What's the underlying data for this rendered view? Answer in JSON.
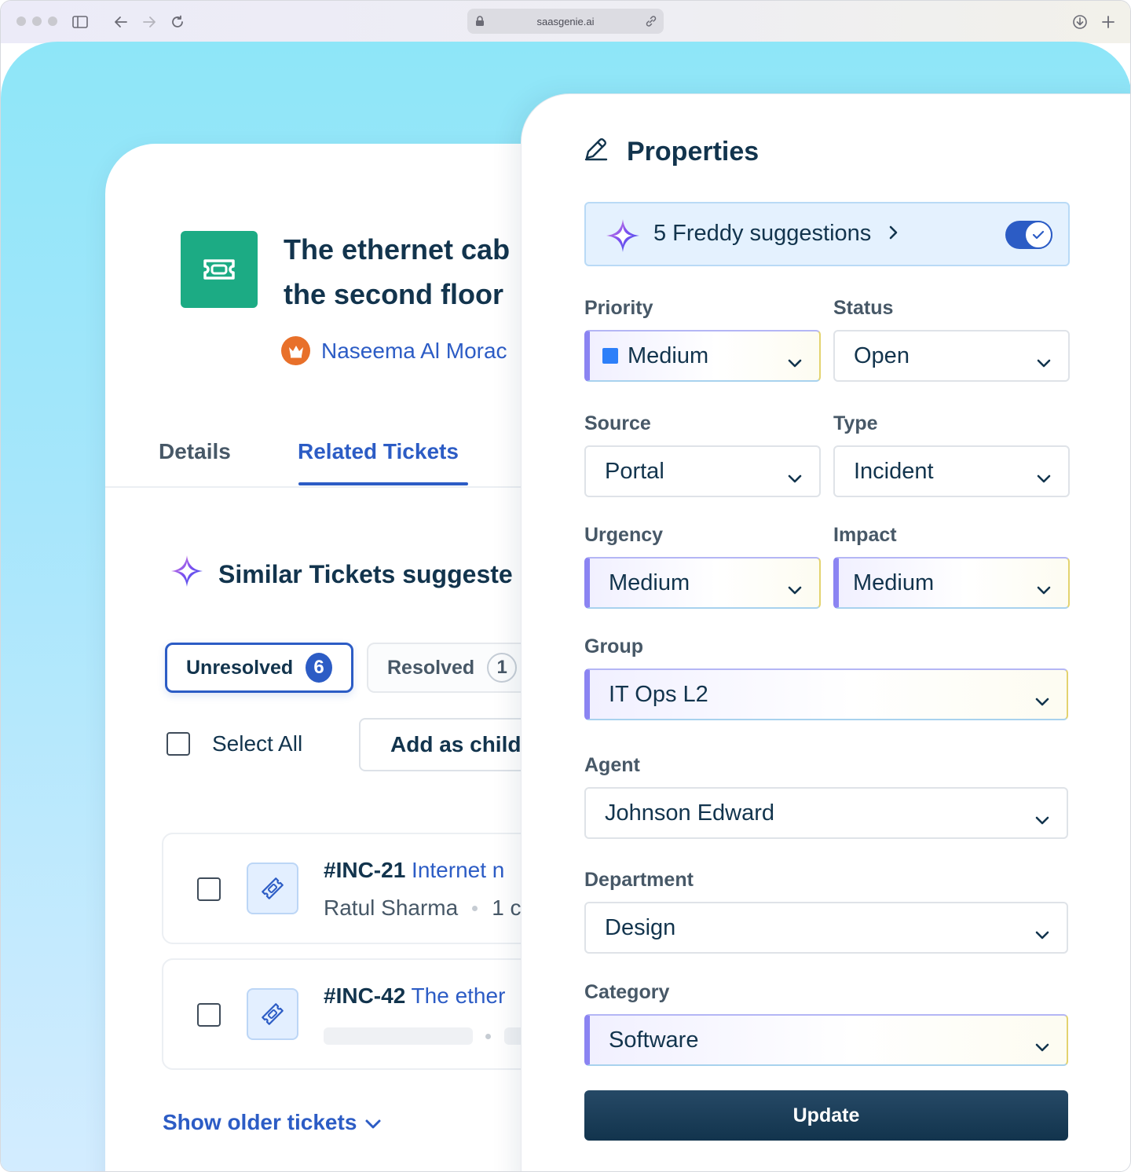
{
  "browser": {
    "url": "saasgenie.ai"
  },
  "ticket": {
    "title_line1": "The ethernet cab",
    "title_line2": "the second floor",
    "requester": "Naseema Al Morac",
    "tabs": [
      {
        "label": "Details"
      },
      {
        "label": "Related Tickets"
      }
    ],
    "similar_heading": "Similar Tickets suggeste",
    "filters": {
      "unresolved_label": "Unresolved",
      "unresolved_count": "6",
      "resolved_label": "Resolved",
      "resolved_count": "1"
    },
    "select_all_label": "Select All",
    "add_child_label": "Add as child",
    "rows": [
      {
        "number": "#INC-21",
        "title": "Internet n",
        "agent": "Ratul Sharma",
        "time": "1 c"
      },
      {
        "number": "#INC-42",
        "title": "The ether"
      }
    ],
    "show_older_label": "Show older tickets"
  },
  "properties": {
    "title": "Properties",
    "freddy_label": "5 Freddy suggestions",
    "freddy_enabled": true,
    "fields": {
      "priority": {
        "label": "Priority",
        "value": "Medium",
        "color": "#2d7ff9"
      },
      "status": {
        "label": "Status",
        "value": "Open"
      },
      "source": {
        "label": "Source",
        "value": "Portal"
      },
      "type": {
        "label": "Type",
        "value": "Incident"
      },
      "urgency": {
        "label": "Urgency",
        "value": "Medium"
      },
      "impact": {
        "label": "Impact",
        "value": "Medium"
      },
      "group": {
        "label": "Group",
        "value": "IT Ops L2"
      },
      "agent": {
        "label": "Agent",
        "value": "Johnson Edward"
      },
      "department": {
        "label": "Department",
        "value": "Design"
      },
      "category": {
        "label": "Category",
        "value": "Software"
      }
    },
    "update_label": "Update"
  },
  "colors": {
    "accent": "#2c5cc5",
    "text_primary": "#12344d",
    "ticket_icon_bg": "#1cab84",
    "crown_bg": "#e8702a",
    "ai_purple": "#7b4ff0"
  },
  "icons": {
    "sidebar": "sidebar-toggle-icon",
    "back": "arrow-left-icon",
    "forward": "arrow-right-icon",
    "reload": "reload-icon",
    "lock": "lock-icon",
    "link": "link-icon",
    "download": "download-icon",
    "new_tab": "plus-icon",
    "ticket": "ticket-icon",
    "crown": "crown-icon",
    "sparkle": "sparkle-icon",
    "pencil": "pencil-icon",
    "chevron": "chevron-down-icon"
  }
}
